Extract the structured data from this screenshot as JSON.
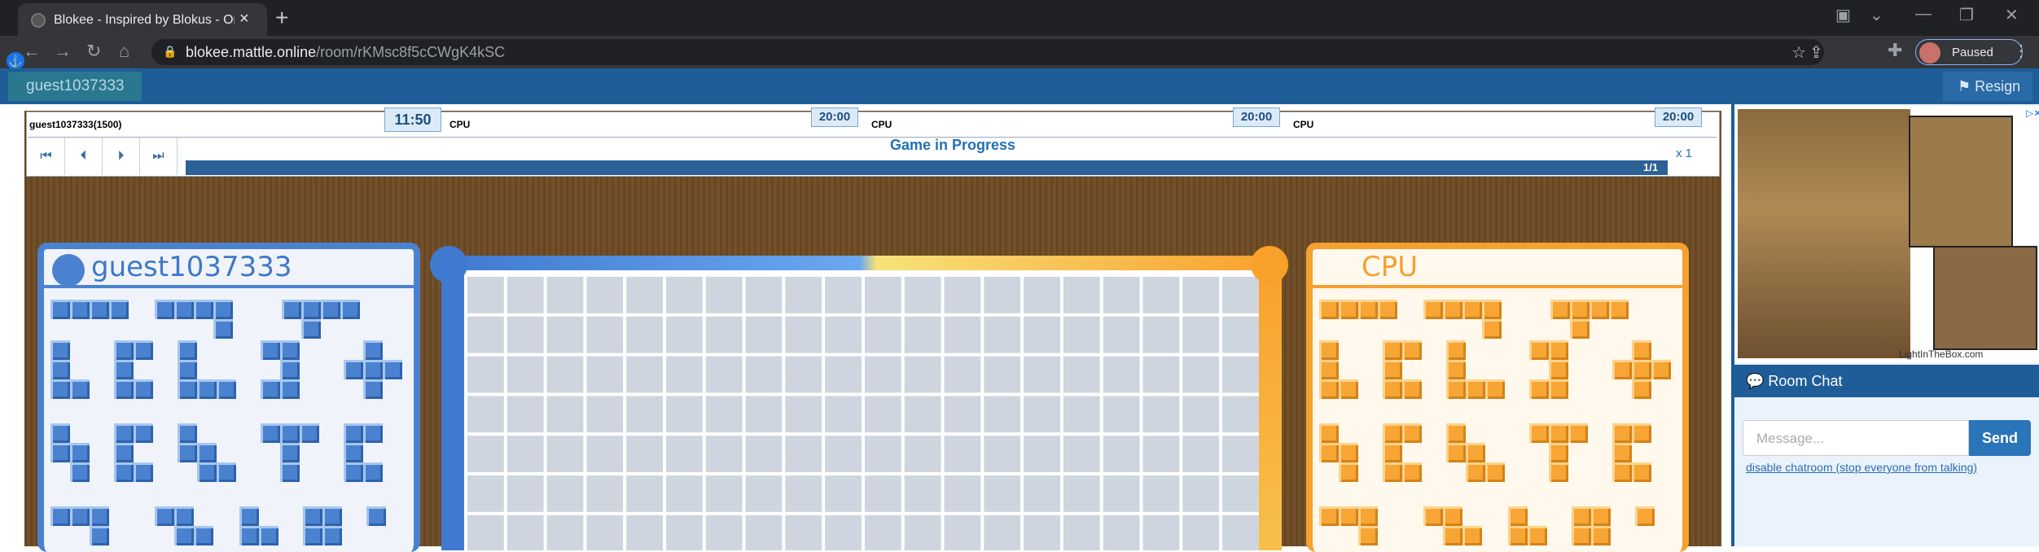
{
  "browser": {
    "tab_title": "Blokee - Inspired by Blokus - Onl",
    "url_host": "blokee.mattle.online",
    "url_path": "/room/rKMsc8f5cCWgK4kSC",
    "profile_label": "Paused"
  },
  "header": {
    "username": "guest1037333",
    "resign_label": "Resign"
  },
  "players": [
    {
      "label": "guest1037333(1500)",
      "clock": "11:50"
    },
    {
      "label": "CPU",
      "clock": "20:00"
    },
    {
      "label": "CPU",
      "clock": "20:00"
    },
    {
      "label": "CPU",
      "clock": "20:00"
    }
  ],
  "game": {
    "status": "Game in Progress",
    "move_counter": "1/1",
    "speed": "x 1",
    "board_size": 20
  },
  "panels": {
    "left_name": "guest1037333",
    "right_name": "CPU"
  },
  "colors": {
    "blue": "#4a82d0",
    "orange": "#f7a535",
    "header": "#1f5d99"
  },
  "chat": {
    "title": "Room Chat",
    "placeholder": "Message...",
    "send_label": "Send",
    "disable_link": "disable chatroom (stop everyone from talking)"
  },
  "ad": {
    "logo": "LightInTheBox.com"
  }
}
